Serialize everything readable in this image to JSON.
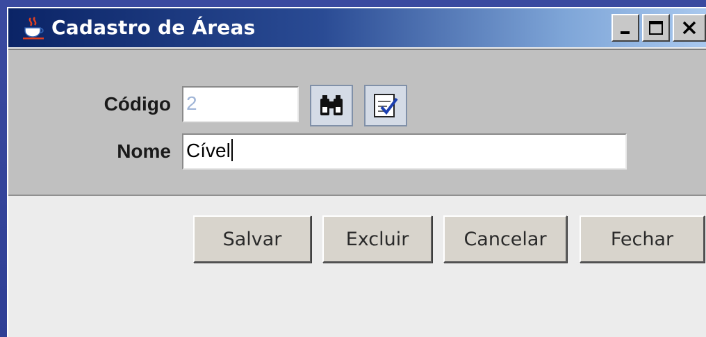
{
  "window": {
    "title": "Cadastro de Áreas",
    "controls": {
      "minimize": "minimize",
      "maximize": "maximize",
      "close": "close"
    }
  },
  "form": {
    "codigo": {
      "label": "Código",
      "value": "2"
    },
    "nome": {
      "label": "Nome",
      "value": "Cível"
    },
    "icons": {
      "search": "binoculars-icon",
      "select": "checklist-icon"
    }
  },
  "buttons": {
    "salvar": "Salvar",
    "excluir": "Excluir",
    "cancelar": "Cancelar",
    "fechar": "Fechar"
  },
  "colors": {
    "titlebar_start": "#0b2466",
    "titlebar_end": "#a9c8ee",
    "panel": "#c0c0c0",
    "button_face": "#d8d4cc",
    "code_text": "#9fb4d6"
  }
}
